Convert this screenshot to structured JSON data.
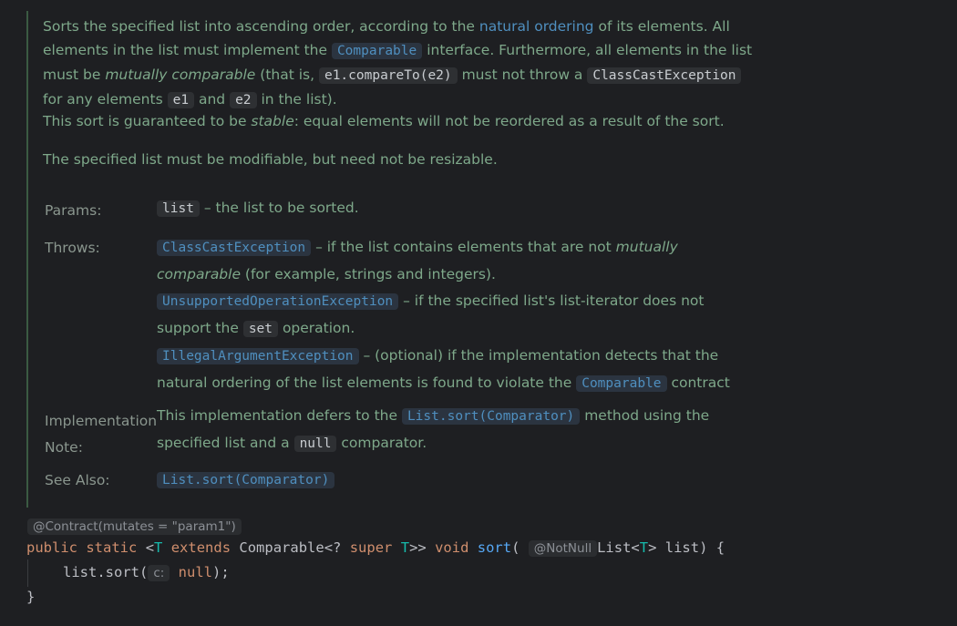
{
  "doc": {
    "p1": {
      "t1": "Sorts the specified list into ascending order, according to the ",
      "natural_ordering": "natural ordering",
      "t2": " of its elements. All",
      "t3": "elements in the list must implement the ",
      "comparable": "Comparable",
      "t4": " interface. Furthermore, all elements in the list",
      "t5": "must be ",
      "mutually_comparable": "mutually comparable",
      "t6": " (that is, ",
      "e1_compare": "e1.compareTo(e2)",
      "t7": " must not throw a ",
      "cce": "ClassCastException",
      "t8": "for any elements ",
      "e1": "e1",
      "t9": " and ",
      "e2": "e2",
      "t10": " in the list)."
    },
    "p2": {
      "t1": "This sort is guaranteed to be ",
      "stable": "stable",
      "t2": ": equal elements will not be reordered as a result of the sort."
    },
    "p3": "The specified list must be modifiable, but need not be resizable.",
    "params": {
      "label": "Params:",
      "code": "list",
      "desc": " – the list to be sorted."
    },
    "throws": {
      "label": "Throws:",
      "cce": "ClassCastException",
      "cce_desc1": " – if the list contains elements that are not ",
      "cce_em1": "mutually",
      "cce_em2": "comparable",
      "cce_desc2": " (for example, strings and integers).",
      "uoe": "UnsupportedOperationException",
      "uoe_desc1": " – if the specified list's list-iterator does not",
      "uoe_desc2": "support the ",
      "uoe_set": "set",
      "uoe_desc3": " operation.",
      "iae": "IllegalArgumentException",
      "iae_desc1": " – (optional) if the implementation detects that the",
      "iae_desc2": "natural ordering of the list elements is found to violate the ",
      "iae_comparable": "Comparable",
      "iae_desc3": " contract"
    },
    "impl": {
      "label1": "Implementation",
      "label2": "Note:",
      "t1": "This implementation defers to the ",
      "link": "List.sort(Comparator)",
      "t2": " method using the",
      "t3": "specified list and a ",
      "null_code": "null",
      "t4": " comparator."
    },
    "see": {
      "label": "See Also:",
      "link": "List.sort(Comparator)"
    }
  },
  "code": {
    "annotation": "@Contract(mutates = \"param1\")",
    "public": "public",
    "static": "static",
    "lt": "<",
    "T1": "T",
    "extends": "extends",
    "comparable_q": "Comparable<?",
    "super": "super",
    "T2": "T",
    "gt": ">>",
    "void": "void",
    "sort": "sort",
    "paren_open": "(",
    "notnull": "@NotNull",
    "list_type_a": "List<",
    "T3": "T",
    "list_type_b": "> list) {",
    "body_call": "list.sort(",
    "hint_c": "c:",
    "null": "null",
    "body_end": ");",
    "close_brace": "}"
  }
}
